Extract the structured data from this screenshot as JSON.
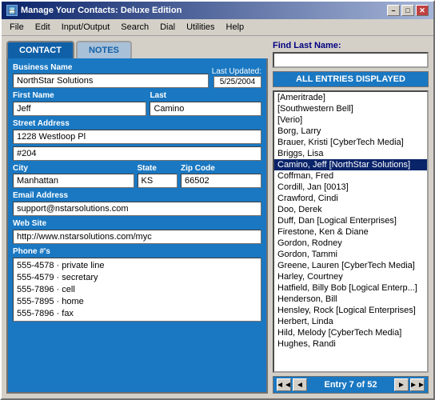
{
  "window": {
    "title": "Manage Your Contacts: Deluxe Edition",
    "icon": "📇"
  },
  "title_buttons": {
    "minimize": "–",
    "maximize": "□",
    "close": "✕"
  },
  "menu": {
    "items": [
      "File",
      "Edit",
      "Input/Output",
      "Search",
      "Dial",
      "Utilities",
      "Help"
    ]
  },
  "tabs": [
    {
      "id": "contact",
      "label": "CONTACT",
      "active": true
    },
    {
      "id": "notes",
      "label": "NOTES",
      "active": false
    }
  ],
  "form": {
    "business_name_label": "Business Name",
    "business_name_value": "NorthStar Solutions",
    "last_updated_label": "Last Updated:",
    "last_updated_value": "5/25/2004",
    "first_name_label": "First Name",
    "first_name_value": "Jeff",
    "last_name_label": "Last",
    "last_name_value": "Camino",
    "street_address_label": "Street Address",
    "street_address_value": "1228 Westloop Pl",
    "street_address2_value": "#204",
    "city_label": "City",
    "city_value": "Manhattan",
    "state_label": "State",
    "state_value": "KS",
    "zip_label": "Zip Code",
    "zip_value": "66502",
    "email_label": "Email Address",
    "email_value": "support@nstarsolutions.com",
    "website_label": "Web Site",
    "website_value": "http://www.nstarsolutions.com/myc",
    "phones_label": "Phone #'s",
    "phones": [
      "555-4578  · private line",
      "555-4579  · secretary",
      "555-7896  · cell",
      "555-7895  · home",
      "555-7896  · fax"
    ]
  },
  "right_panel": {
    "find_label": "Find Last Name:",
    "find_placeholder": "",
    "entries_header": "ALL ENTRIES DISPLAYED",
    "entries": [
      "[Ameritrade]",
      "[Southwestern Bell]",
      "[Verio]",
      "Borg, Larry",
      "Brauer, Kristi [CyberTech Media]",
      "Briggs, Lisa",
      "Camino, Jeff [NorthStar Solutions]",
      "Coffman, Fred",
      "Cordill, Jan [0013]",
      "Crawford, Cindi",
      "Doo, Derek",
      "Duff, Dan [Logical Enterprises]",
      "Firestone, Ken & Diane",
      "Gordon, Rodney",
      "Gordon, Tammi",
      "Greene, Lauren [CyberTech Media]",
      "Harley, Courtney",
      "Hatfield, Billy Bob [Logical Enterp...]",
      "Henderson, Bill",
      "Hensley, Rock [Logical Enterprises]",
      "Herbert, Linda",
      "Hild, Melody [CyberTech Media]",
      "Hughes, Randi"
    ],
    "selected_index": 6,
    "nav": {
      "first": "◄◄",
      "prev": "◄",
      "entry_text": "Entry 7 of 52",
      "next": "►",
      "last": "►►"
    }
  }
}
